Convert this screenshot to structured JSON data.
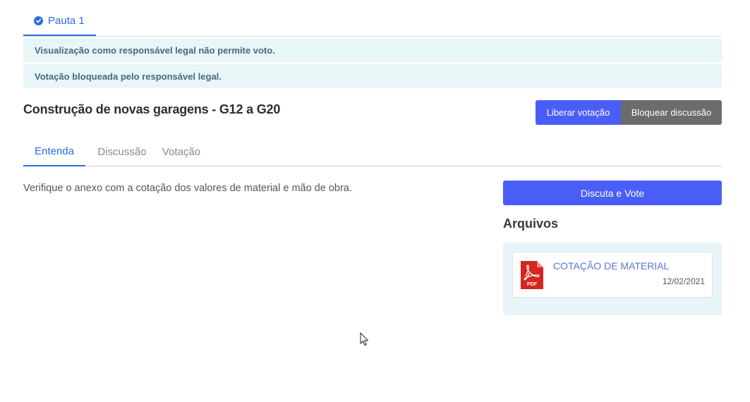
{
  "header": {
    "tab_label": "Pauta 1",
    "tab_icon": "check-circle-icon"
  },
  "alerts": [
    "Visualização como responsável legal não permite voto.",
    "Votação bloqueada pelo responsável legal."
  ],
  "item": {
    "title": "Construção de novas garagens - G12 a G20",
    "description": "Verifique o anexo com a cotação dos valores de material e mão de obra."
  },
  "actions": {
    "release_vote": "Liberar votação",
    "block_discussion": "Bloquear discussão"
  },
  "tabs": [
    "Entenda",
    "Discussão",
    "Votação"
  ],
  "active_tab": "Entenda",
  "sidebar": {
    "vote_button": "Discuta e Vote",
    "files_heading": "Arquivos",
    "files": [
      {
        "name": "COTAÇÃO DE MATERIAL",
        "date": "12/02/2021",
        "icon": "pdf-file-icon",
        "icon_label": "PDF"
      }
    ]
  },
  "colors": {
    "accent": "#2b6de0",
    "primary_button": "#4a5ef7",
    "secondary_button": "#6c6c6c",
    "alert_bg": "#e9f6f8",
    "alert_text": "#476a78",
    "pdf_red": "#d7261f"
  }
}
